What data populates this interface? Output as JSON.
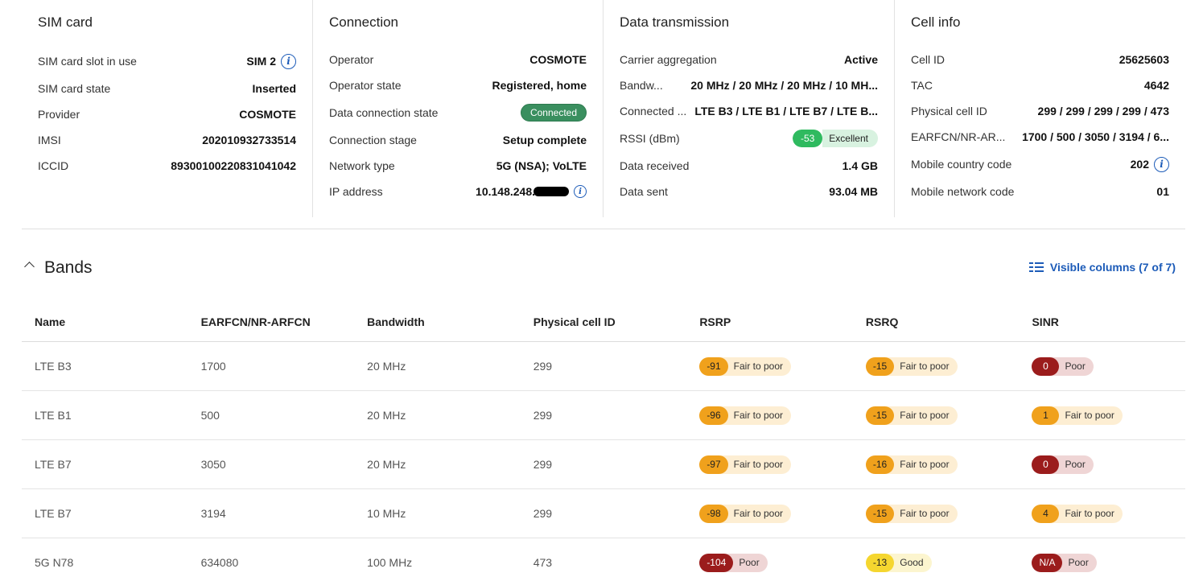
{
  "sim": {
    "title": "SIM card",
    "rows": [
      {
        "label": "SIM card slot in use",
        "value": "SIM 2"
      },
      {
        "label": "SIM card state",
        "value": "Inserted"
      },
      {
        "label": "Provider",
        "value": "COSMOTE"
      },
      {
        "label": "IMSI",
        "value": "202010932733514"
      },
      {
        "label": "ICCID",
        "value": "89300100220831041042"
      }
    ]
  },
  "connection": {
    "title": "Connection",
    "rows": [
      {
        "label": "Operator",
        "value": "COSMOTE"
      },
      {
        "label": "Operator state",
        "value": "Registered, home"
      },
      {
        "label": "Data connection state",
        "value": "Connected"
      },
      {
        "label": "Connection stage",
        "value": "Setup complete"
      },
      {
        "label": "Network type",
        "value": "5G (NSA); VoLTE"
      },
      {
        "label": "IP address",
        "value": "10.148.248."
      }
    ]
  },
  "data_transmission": {
    "title": "Data transmission",
    "rows": [
      {
        "label": "Carrier aggregation",
        "value": "Active"
      },
      {
        "label": "Bandw...",
        "value": "20 MHz / 20 MHz / 20 MHz / 10 MH..."
      },
      {
        "label": "Connected ...",
        "value": "LTE B3 / LTE B1 / LTE B7 / LTE B..."
      },
      {
        "label": "RSSI (dBm)",
        "value": "-53",
        "quality": "Excellent"
      },
      {
        "label": "Data received",
        "value": "1.4 GB"
      },
      {
        "label": "Data sent",
        "value": "93.04 MB"
      }
    ]
  },
  "cell_info": {
    "title": "Cell info",
    "rows": [
      {
        "label": "Cell ID",
        "value": "25625603"
      },
      {
        "label": "TAC",
        "value": "4642"
      },
      {
        "label": "Physical cell ID",
        "value": "299 / 299 / 299 / 299 / 473"
      },
      {
        "label": "EARFCN/NR-AR...",
        "value": "1700 / 500 / 3050 / 3194 / 6..."
      },
      {
        "label": "Mobile country code",
        "value": "202"
      },
      {
        "label": "Mobile network code",
        "value": "01"
      }
    ]
  },
  "bands": {
    "title": "Bands",
    "visible_columns": "Visible columns (7 of 7)",
    "columns": [
      "Name",
      "EARFCN/NR-ARFCN",
      "Bandwidth",
      "Physical cell ID",
      "RSRP",
      "RSRQ",
      "SINR"
    ],
    "rows": [
      {
        "name": "LTE B3",
        "arfcn": "1700",
        "bw": "20 MHz",
        "pci": "299",
        "rsrp": {
          "v": "-91",
          "t": "Fair to poor",
          "c": "orange"
        },
        "rsrq": {
          "v": "-15",
          "t": "Fair to poor",
          "c": "orange"
        },
        "sinr": {
          "v": "0",
          "t": "Poor",
          "c": "red"
        }
      },
      {
        "name": "LTE B1",
        "arfcn": "500",
        "bw": "20 MHz",
        "pci": "299",
        "rsrp": {
          "v": "-96",
          "t": "Fair to poor",
          "c": "orange"
        },
        "rsrq": {
          "v": "-15",
          "t": "Fair to poor",
          "c": "orange"
        },
        "sinr": {
          "v": "1",
          "t": "Fair to poor",
          "c": "orange"
        }
      },
      {
        "name": "LTE B7",
        "arfcn": "3050",
        "bw": "20 MHz",
        "pci": "299",
        "rsrp": {
          "v": "-97",
          "t": "Fair to poor",
          "c": "orange"
        },
        "rsrq": {
          "v": "-16",
          "t": "Fair to poor",
          "c": "orange"
        },
        "sinr": {
          "v": "0",
          "t": "Poor",
          "c": "red"
        }
      },
      {
        "name": "LTE B7",
        "arfcn": "3194",
        "bw": "10 MHz",
        "pci": "299",
        "rsrp": {
          "v": "-98",
          "t": "Fair to poor",
          "c": "orange"
        },
        "rsrq": {
          "v": "-15",
          "t": "Fair to poor",
          "c": "orange"
        },
        "sinr": {
          "v": "4",
          "t": "Fair to poor",
          "c": "orange"
        }
      },
      {
        "name": "5G N78",
        "arfcn": "634080",
        "bw": "100 MHz",
        "pci": "473",
        "rsrp": {
          "v": "-104",
          "t": "Poor",
          "c": "red"
        },
        "rsrq": {
          "v": "-13",
          "t": "Good",
          "c": "yellow"
        },
        "sinr": {
          "v": "N/A",
          "t": "Poor",
          "c": "red"
        }
      }
    ]
  },
  "colors": {
    "accent": "#1c5bb8",
    "connected": "#3a8f5f",
    "excellent": "#2fba5f",
    "orange": "#f0a11c",
    "red": "#9b1c1c",
    "yellow": "#f5d62f"
  },
  "icons": [
    "info-icon",
    "chevron-up-icon",
    "columns-icon"
  ]
}
